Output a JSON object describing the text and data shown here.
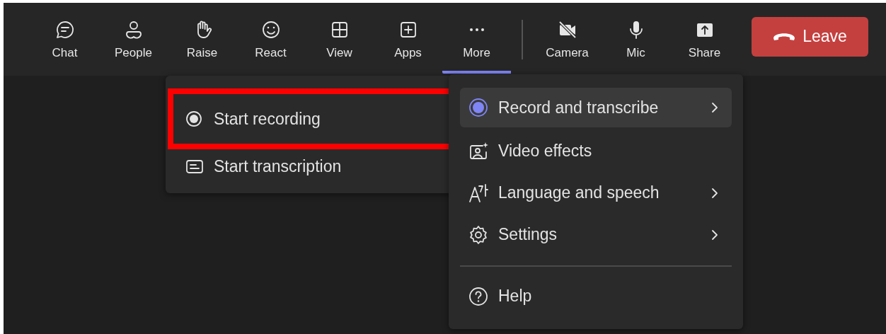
{
  "toolbar": {
    "items": [
      {
        "label": "Chat",
        "selected": false
      },
      {
        "label": "People",
        "selected": false
      },
      {
        "label": "Raise",
        "selected": false
      },
      {
        "label": "React",
        "selected": false
      },
      {
        "label": "View",
        "selected": false
      },
      {
        "label": "Apps",
        "selected": false
      },
      {
        "label": "More",
        "selected": true
      }
    ],
    "devices": [
      {
        "label": "Camera",
        "on": false
      },
      {
        "label": "Mic",
        "on": true
      },
      {
        "label": "Share"
      }
    ],
    "leave_button": "Leave"
  },
  "submenu": {
    "items": [
      {
        "label": "Start recording",
        "highlighted": true
      },
      {
        "label": "Start transcription",
        "highlighted": false
      }
    ]
  },
  "menu": {
    "items": [
      {
        "label": "Record and transcribe",
        "selected": true,
        "submenu": true
      },
      {
        "label": "Video effects",
        "selected": false,
        "submenu": false
      },
      {
        "label": "Language and speech",
        "selected": false,
        "submenu": true
      },
      {
        "label": "Settings",
        "selected": false,
        "submenu": true
      }
    ],
    "footer_items": [
      {
        "label": "Help"
      }
    ]
  }
}
